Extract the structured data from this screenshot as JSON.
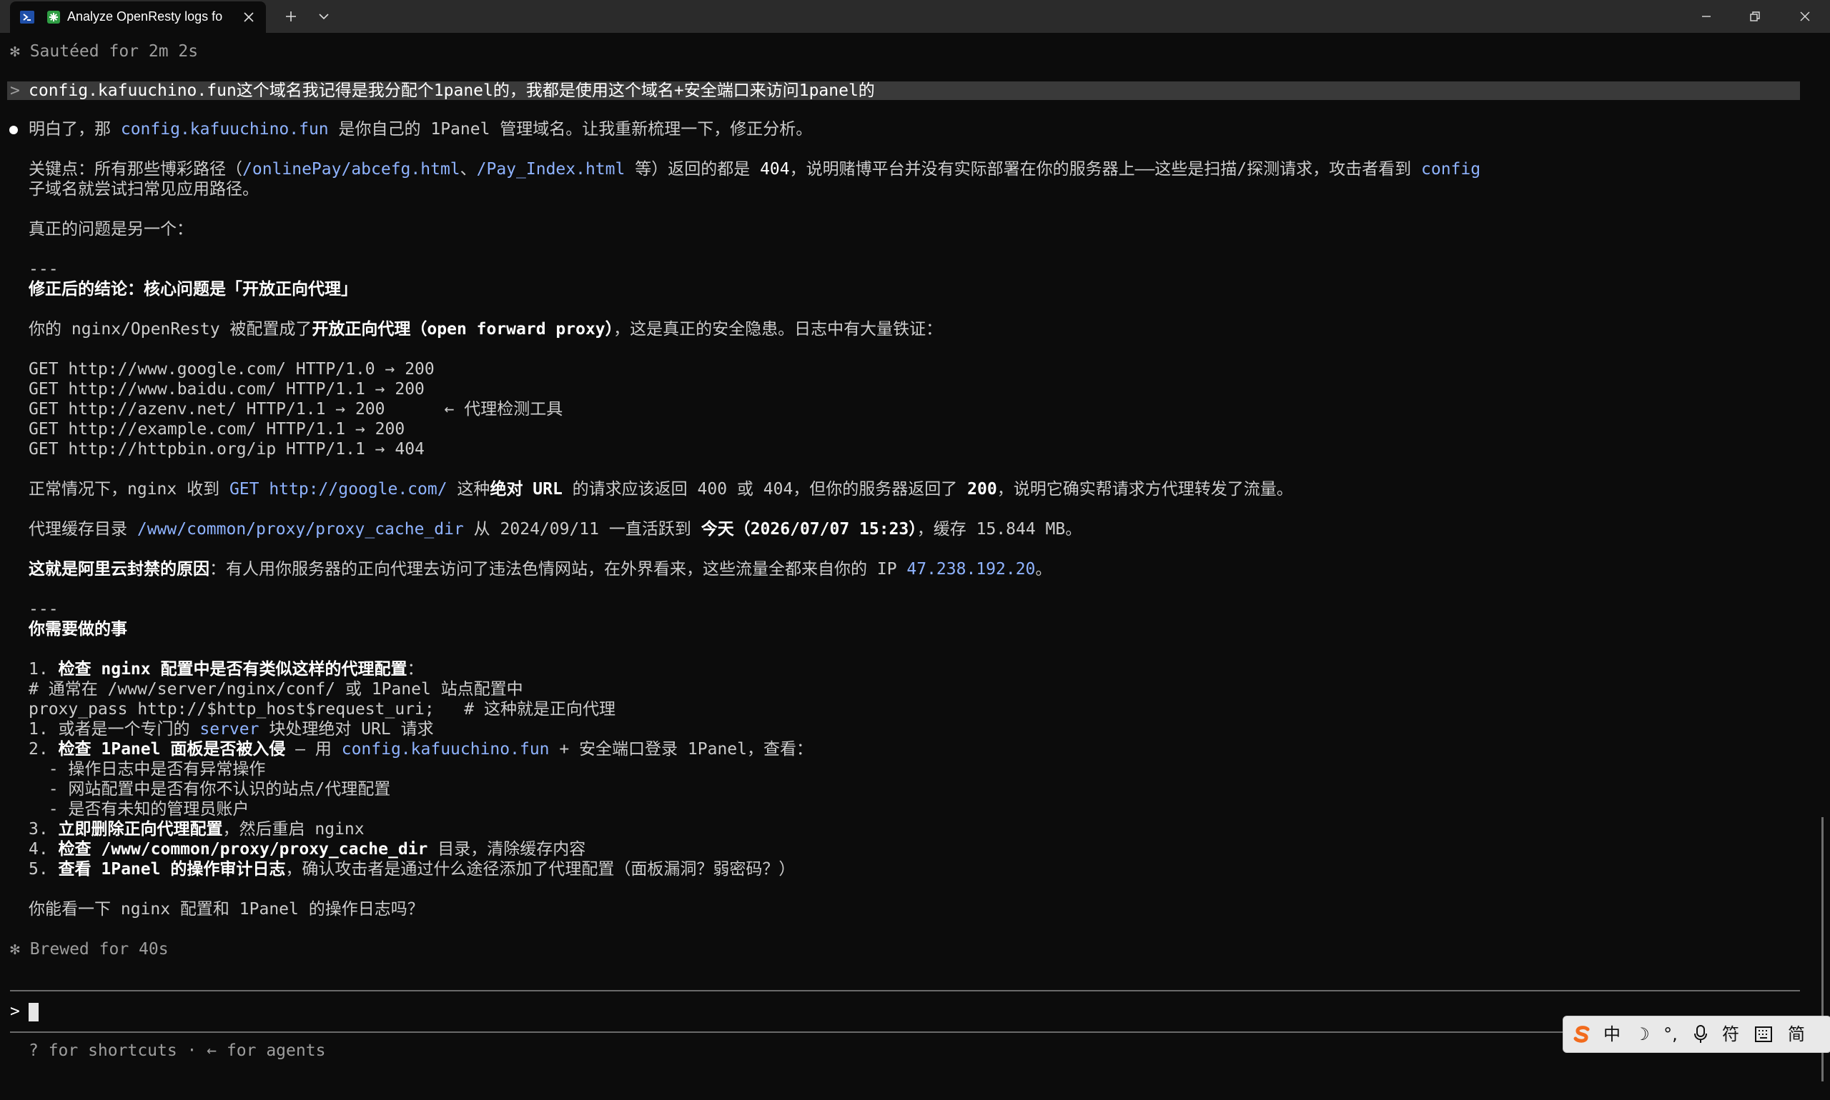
{
  "window": {
    "tab_title": "Analyze OpenResty logs fo",
    "icons": {
      "shell": "powershell-icon",
      "tab": "claude-icon",
      "close": "close-icon",
      "new_tab": "plus-icon",
      "dropdown": "chevron-down-icon",
      "minimize": "minimize-icon",
      "maximize": "restore-icon",
      "window_close": "window-close-icon"
    }
  },
  "terminal": {
    "status_top": "✻ Sautéed for 2m 2s",
    "user_prompt_marker": ">",
    "user_message": "config.kafuuchino.fun这个域名我记得是我分配个1panel的，我都是使用这个域名+安全端口来访问1panel的",
    "l1a": "明白了，那 ",
    "l1b": "config.kafuuchino.fun",
    "l1c": " 是你自己的 1Panel 管理域名。让我重新梳理一下，修正分析。",
    "l2a": "关键点：所有那些博彩路径（",
    "l2b": "/onlinePay/abcefg.html",
    "l2c": "、",
    "l2d": "/Pay_Index.html",
    "l2e": " 等）返回的都是 ",
    "l2f": "404",
    "l2g": "，说明赌博平台并没有实际部署在你的服务器上——这些是扫描/探测请求，攻击者看到 ",
    "l2h": "config",
    "l3": "子域名就尝试扫常见应用路径。",
    "l4": "真正的问题是另一个：",
    "l5": "---",
    "l6": "修正后的结论：核心问题是「开放正向代理」",
    "l7a": "你的 nginx/OpenResty 被配置成了",
    "l7b": "开放正向代理（open forward proxy）",
    "l7c": "，这是真正的安全隐患。日志中有大量铁证：",
    "get1": "GET http://www.google.com/ HTTP/1.0 → 200",
    "get2": "GET http://www.baidu.com/ HTTP/1.1 → 200",
    "get3": "GET http://azenv.net/ HTTP/1.1 → 200      ← 代理检测工具",
    "get4": "GET http://example.com/ HTTP/1.1 → 200",
    "get5": "GET http://httpbin.org/ip HTTP/1.1 → 404",
    "l8a": "正常情况下，nginx 收到 ",
    "l8b": "GET http://google.com/",
    "l8c": " 这种",
    "l8d": "绝对 URL",
    "l8e": " 的请求应该返回 400 或 404，但你的服务器返回了 ",
    "l8f": "200",
    "l8g": "，说明它确实帮请求方代理转发了流量。",
    "l9a": "代理缓存目录 ",
    "l9b": "/www/common/proxy/proxy_cache_dir",
    "l9c": " 从 2024/09/11 一直活跃到 ",
    "l9d": "今天（2026/07/07 15:23）",
    "l9e": "，缓存 15.844 MB。",
    "l10a": "这就是阿里云封禁的原因",
    "l10b": "：有人用你服务器的正向代理去访问了违法色情网站，在外界看来，这些流量全都来自你的 IP ",
    "l10c": "47.238.192.20",
    "l10d": "。",
    "l11": "---",
    "l12": "你需要做的事",
    "s1a": "1. ",
    "s1b": "检查 nginx 配置中是否有类似这样的代理配置",
    "s1c": "：",
    "s2": "# 通常在 /www/server/nginx/conf/ 或 1Panel 站点配置中",
    "s3": "proxy_pass http://$http_host$request_uri;   # 这种就是正向代理",
    "s4a": "1. 或者是一个专门的 ",
    "s4b": "server",
    "s4c": " 块处理绝对 URL 请求",
    "s5a": "2. ",
    "s5b": "检查 1Panel 面板是否被入侵",
    "s5c": " — 用 ",
    "s5d": "config.kafuuchino.fun",
    "s5e": " + 安全端口登录 1Panel，查看：",
    "s6": "  - 操作日志中是否有异常操作",
    "s7": "  - 网站配置中是否有你不认识的站点/代理配置",
    "s8": "  - 是否有未知的管理员账户",
    "s9a": "3. ",
    "s9b": "立即删除正向代理配置",
    "s9c": "，然后重启 nginx",
    "s10a": "4. ",
    "s10b": "检查 ",
    "s10c": "/www/common/proxy/proxy_cache_dir",
    "s10d": " 目录，清除缓存内容",
    "s11a": "5. ",
    "s11b": "查看 1Panel 的操作审计日志",
    "s11c": "，确认攻击者是通过什么途径添加了代理配置（面板漏洞？弱密码？）",
    "l13": "你能看一下 nginx 配置和 1Panel 的操作日志吗？",
    "status_bottom": "✻ Brewed for 40s",
    "input_prompt": ">",
    "hint": "? for shortcuts · ← for agents"
  },
  "ime": {
    "logo": "sogou-logo",
    "items": [
      "中",
      "☽",
      "°,",
      "mic-icon",
      "符",
      "keyboard-icon",
      "简"
    ]
  },
  "colors": {
    "background": "#0c0c0c",
    "titlebar": "#2b2b2b",
    "text": "#cccccc",
    "highlight": "#8fb3ff",
    "user_bar": "#3a3a3a",
    "ime_logo": "#f26b1d"
  }
}
